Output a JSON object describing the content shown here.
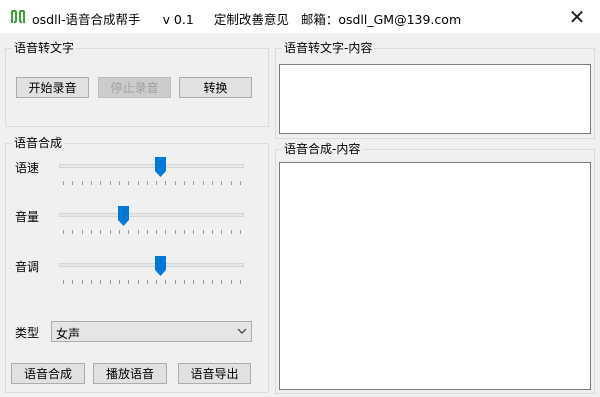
{
  "titlebar": {
    "app_name": "osdll-语音合成帮手",
    "version": "v 0.1",
    "feedback": "定制改善意见",
    "email": "邮箱：osdll_GM@139.com",
    "close_glyph": "✕",
    "icon": "app-logo-icon"
  },
  "stt_group": {
    "label": "语音转文字",
    "start_button": "开始录音",
    "stop_button": "停止录音",
    "convert_button": "转换"
  },
  "stt_content": {
    "label": "语音转文字-内容",
    "value": ""
  },
  "tts_group": {
    "label": "语音合成",
    "sliders": [
      {
        "label": "语速",
        "level": 0.55
      },
      {
        "label": "音量",
        "level": 0.35
      },
      {
        "label": "音调",
        "level": 0.55
      }
    ],
    "type_label": "类型",
    "type_value": "女声",
    "synthesize_button": "语音合成",
    "play_button": "播放语音",
    "export_button": "语音导出"
  },
  "tts_content": {
    "label": "语音合成-内容",
    "value": ""
  },
  "colors": {
    "thumb": "#0078d7",
    "titlebar_bg": "#ffffff",
    "window_bg": "#f0f0f0",
    "logo": "#3aa335"
  }
}
